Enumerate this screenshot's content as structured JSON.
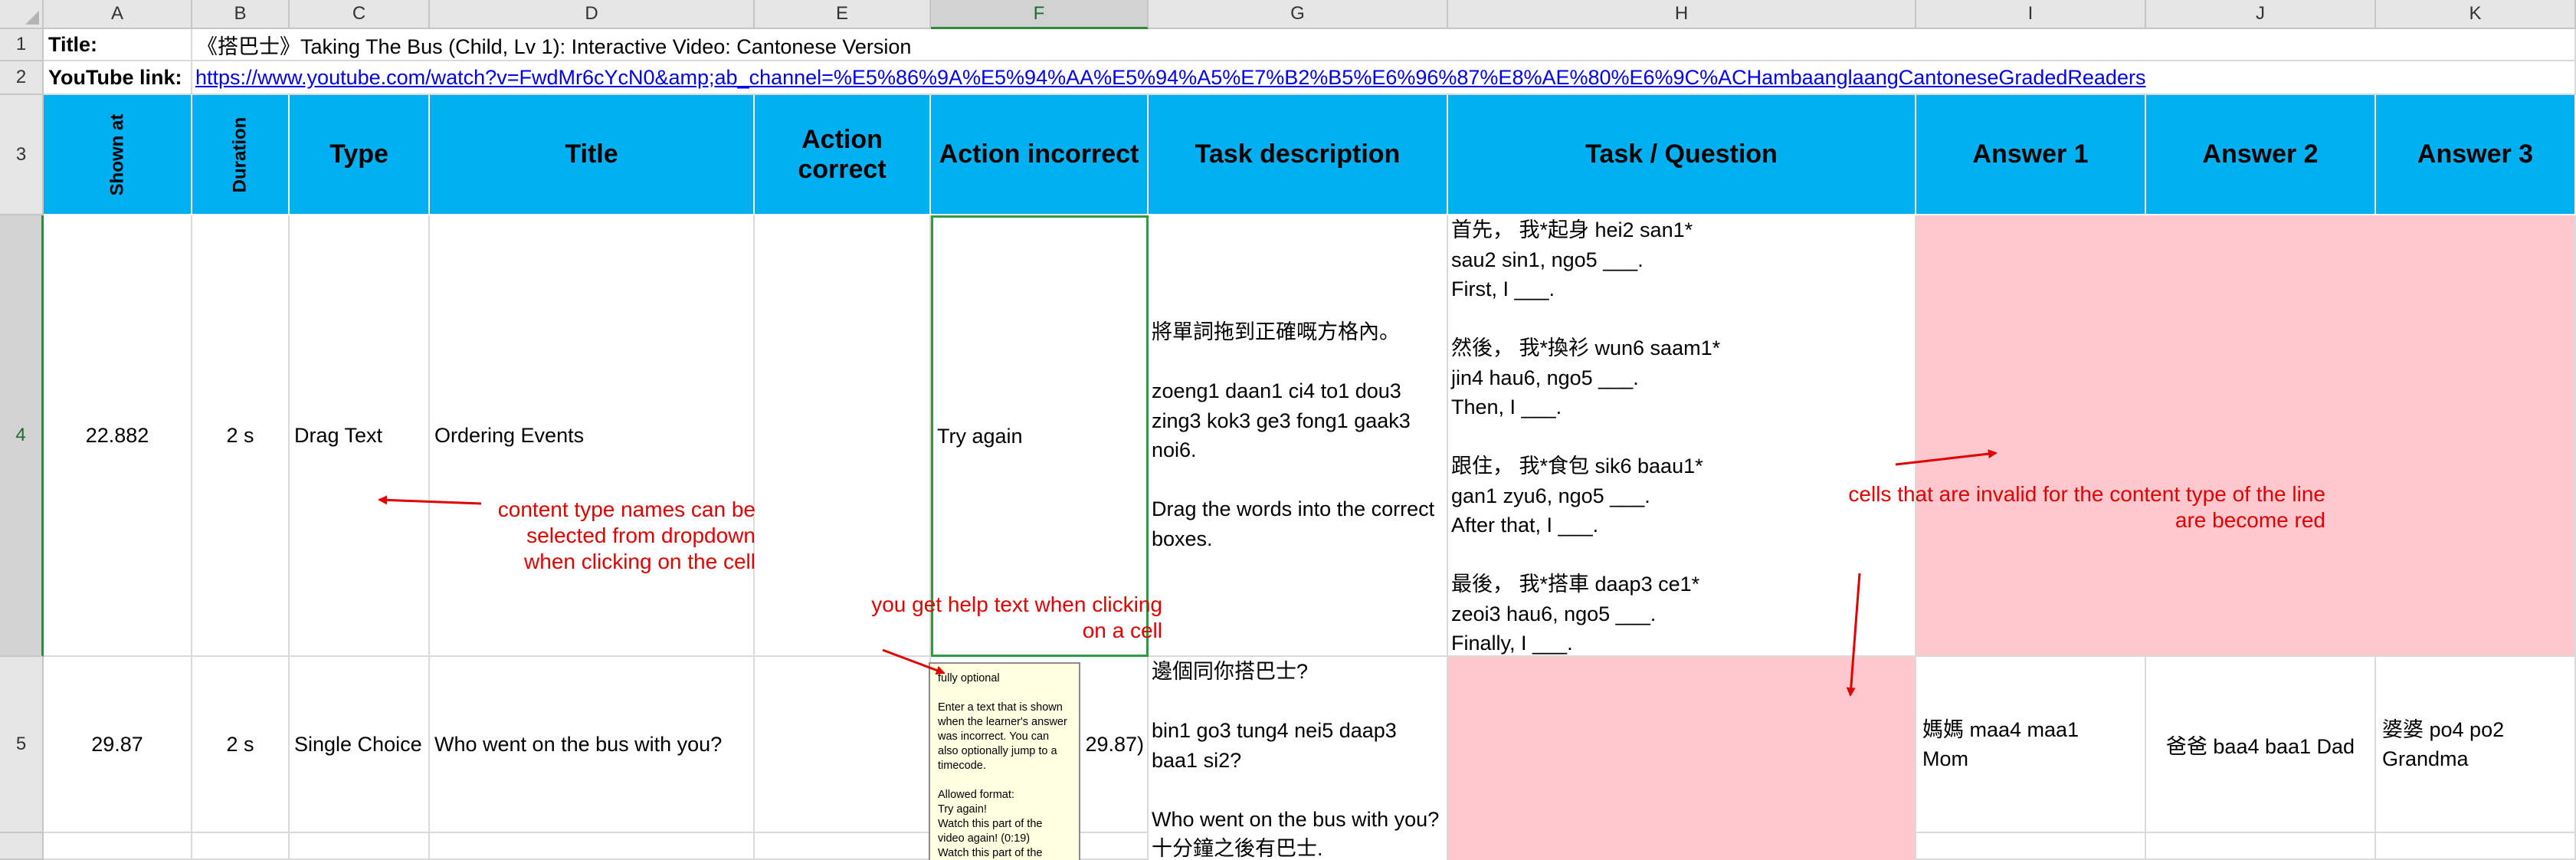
{
  "columns": [
    "A",
    "B",
    "C",
    "D",
    "E",
    "F",
    "G",
    "H",
    "I",
    "J",
    "K"
  ],
  "rows": [
    "1",
    "2",
    "3",
    "4",
    "5"
  ],
  "row1": {
    "label": "Title:",
    "value": "《搭巴士》Taking The Bus (Child, Lv 1): Interactive Video: Cantonese Version"
  },
  "row2": {
    "label": "YouTube link:",
    "value": "https://www.youtube.com/watch?v=FwdMr6cYcN0&amp;ab_channel=%E5%86%9A%E5%94%AA%E5%94%A5%E7%B2%B5%E6%96%87%E8%AE%80%E6%9C%ACHambaanglaangCantoneseGradedReaders"
  },
  "headers": {
    "shown_at": "Shown at",
    "duration": "Duration",
    "type": "Type",
    "title": "Title",
    "action_correct": "Action correct",
    "action_incorrect": "Action incorrect",
    "task_description": "Task description",
    "task_question": "Task / Question",
    "answer1": "Answer 1",
    "answer2": "Answer 2",
    "answer3": "Answer 3"
  },
  "row4": {
    "shown_at": "22.882",
    "duration": "2 s",
    "type": "Drag Text",
    "title": "Ordering Events",
    "action_incorrect": "Try again",
    "task_description": "將單詞拖到正確嘅方格內。\n\nzoeng1 daan1 ci4 to1 dou3 zing3 kok3 ge3 fong1 gaak3 noi6.\n\nDrag the words into the correct boxes.",
    "task_question": "首先， 我*起身 hei2 san1*\nsau2 sin1, ngo5 ___.\nFirst, I ___.\n\n然後， 我*換衫 wun6 saam1*\njin4 hau6, ngo5 ___.\nThen, I ___.\n\n跟住， 我*食包 sik6 baau1*\ngan1 zyu6, ngo5 ___.\nAfter that, I ___.\n\n最後， 我*搭車 daap3 ce1*\nzeoi3 hau6, ngo5 ___.\nFinally, I ___."
  },
  "row5": {
    "shown_at": "29.87",
    "duration": "2 s",
    "type": "Single Choice",
    "title": "Who went on the bus with you?",
    "action_incorrect_partial": "29.87)",
    "task_description": "邊個同你搭巴士?\n\nbin1 go3 tung4 nei5 daap3 baa1 si2?\n\nWho went on the bus with you?\n十分鐘之後有巴士.",
    "answer1": "媽媽 maa4 maa1 Mom",
    "answer2": "爸爸 baa4 baa1 Dad",
    "answer3": "婆婆 po4 po2 Grandma"
  },
  "annotations": {
    "dropdown_note": "content type names can be\nselected from dropdown\nwhen clicking on the cell",
    "help_note": "you get help text when clicking\non a cell",
    "invalid_note": "cells that are invalid for the content type of the line\nare become red"
  },
  "tooltip": {
    "text": "fully optional\n\nEnter a text that is shown when the learner's answer was incorrect. You can also optionally jump to a timecode.\n\nAllowed format:\nTry again!\nWatch this part of the video again! (0:19)\nWatch this part of the"
  },
  "colors": {
    "header_blue": "#00b0f0",
    "invalid_pink": "#ffc7ce",
    "note_red": "#e00000",
    "selection_green": "#2e9a44"
  }
}
